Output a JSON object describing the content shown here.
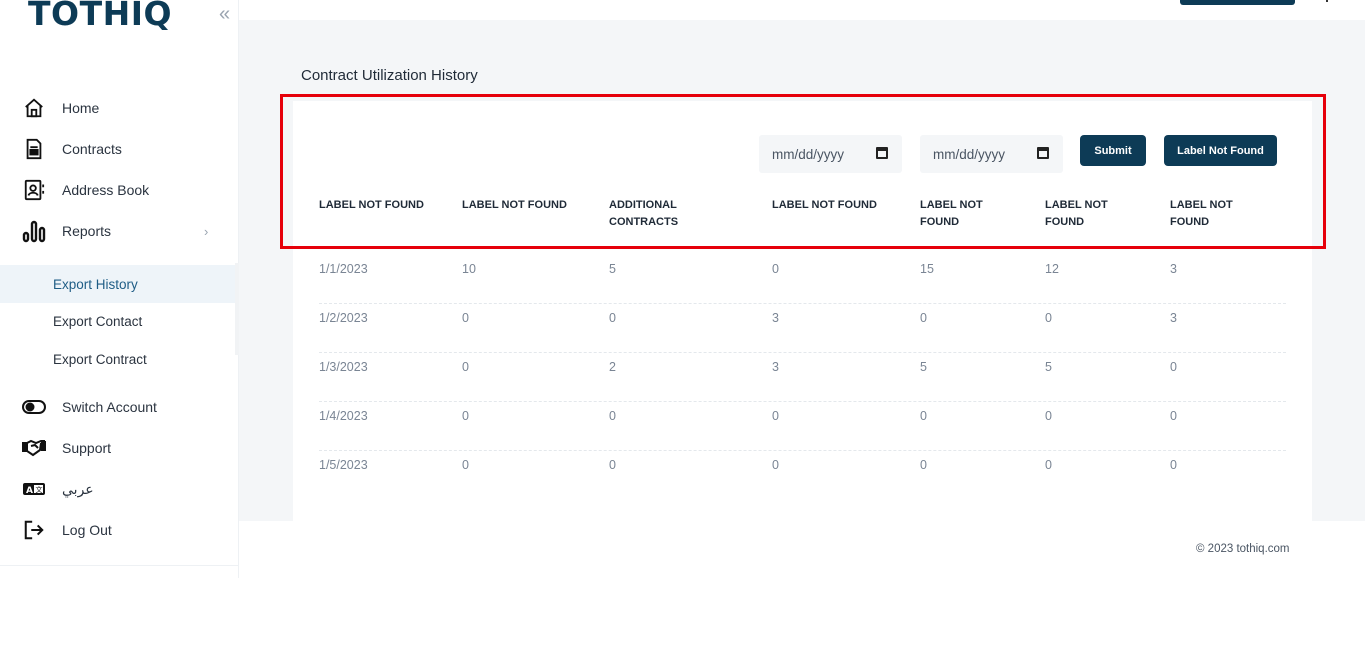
{
  "brand": {
    "logo": "TOTHIQ"
  },
  "sidebar": {
    "collapse": "«",
    "items": [
      {
        "label": "Home",
        "icon": "home-icon"
      },
      {
        "label": "Contracts",
        "icon": "document-icon"
      },
      {
        "label": "Address Book",
        "icon": "address-book-icon"
      },
      {
        "label": "Reports",
        "icon": "bar-chart-icon",
        "chevron": "›"
      }
    ],
    "sub_items": [
      {
        "label": "Export History",
        "active": true
      },
      {
        "label": "Export Contact",
        "active": false
      },
      {
        "label": "Export Contract",
        "active": false
      }
    ],
    "bottom_items": [
      {
        "label": "Switch Account",
        "icon": "toggle-icon"
      },
      {
        "label": "Support",
        "icon": "handshake-icon"
      },
      {
        "label": "عربي",
        "icon": "language-icon"
      },
      {
        "label": "Log Out",
        "icon": "logout-icon"
      }
    ]
  },
  "page": {
    "title": "Contract Utilization History",
    "filters": {
      "from_placeholder": "mm/dd/yyyy",
      "to_placeholder": "mm/dd/yyyy",
      "submit_label": "Submit",
      "export_label": "Label Not Found"
    },
    "table": {
      "headers": [
        "LABEL NOT FOUND",
        "LABEL NOT FOUND",
        "ADDITIONAL CONTRACTS",
        "LABEL NOT FOUND",
        "LABEL NOT FOUND",
        "LABEL NOT FOUND",
        "LABEL NOT FOUND"
      ],
      "rows": [
        [
          "1/1/2023",
          "10",
          "5",
          "0",
          "15",
          "12",
          "3"
        ],
        [
          "1/2/2023",
          "0",
          "0",
          "3",
          "0",
          "0",
          "3"
        ],
        [
          "1/3/2023",
          "0",
          "2",
          "3",
          "5",
          "5",
          "0"
        ],
        [
          "1/4/2023",
          "0",
          "0",
          "0",
          "0",
          "0",
          "0"
        ],
        [
          "1/5/2023",
          "0",
          "0",
          "0",
          "0",
          "0",
          "0"
        ]
      ]
    }
  },
  "footer": {
    "copyright": "© 2023 tothiq.com"
  },
  "colors": {
    "brand": "#0d3b56",
    "highlight": "#e6000a",
    "background": "#f4f6f8"
  }
}
